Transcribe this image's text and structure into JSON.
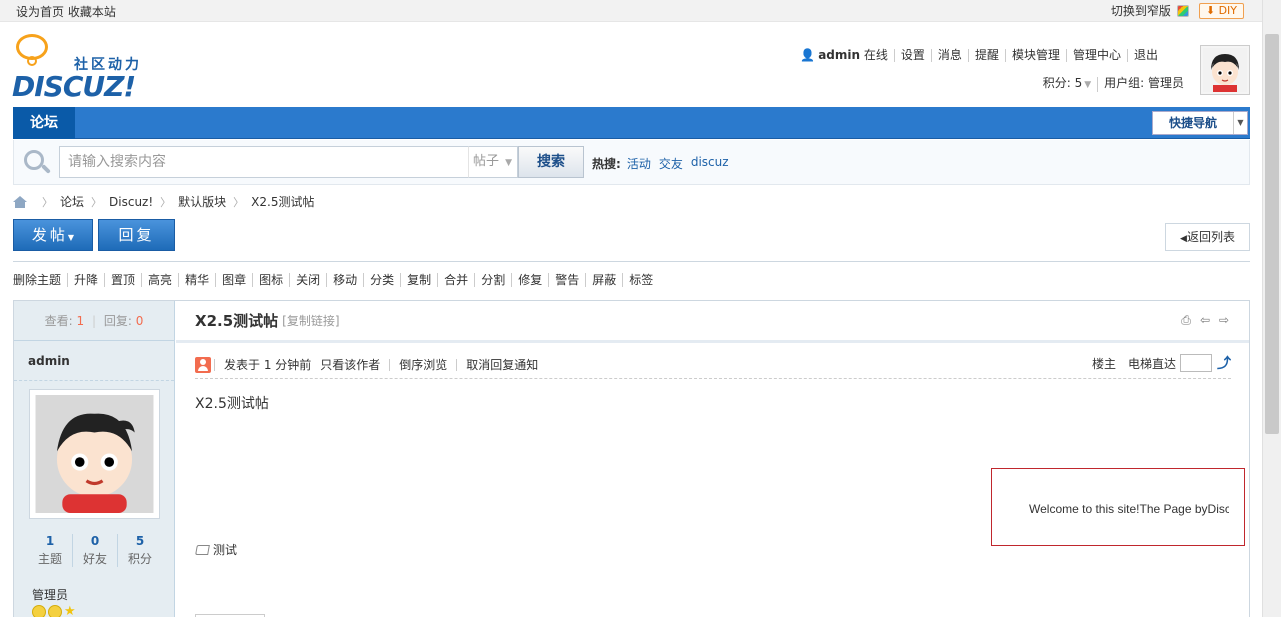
{
  "topbar": {
    "set_home": "设为首页",
    "bookmark": "收藏本站",
    "switch_width": "切换到窄版",
    "diy_label": "DIY",
    "diy_arrow": "⬇"
  },
  "logo": {
    "tagline": "社区动力",
    "wordmark": "DISCUZ!"
  },
  "user": {
    "name": "admin",
    "status": "在线",
    "links": [
      "设置",
      "消息",
      "提醒",
      "模块管理",
      "管理中心",
      "退出"
    ],
    "points_label": "积分: 5",
    "group_label": "用户组: 管理员"
  },
  "nav": {
    "forum_tab": "论坛",
    "quick_nav": "快捷导航"
  },
  "search": {
    "placeholder": "请输入搜索内容",
    "type": "帖子",
    "button": "搜索",
    "hot_label": "热搜:",
    "hot_links": [
      "活动",
      "交友",
      "discuz"
    ]
  },
  "breadcrumb": [
    "论坛",
    "Discuz!",
    "默认版块",
    "X2.5测试帖"
  ],
  "actions": {
    "post": "发帖",
    "reply": "回复",
    "back": "返回列表"
  },
  "moderation": [
    "删除主题",
    "升降",
    "置顶",
    "高亮",
    "精华",
    "图章",
    "图标",
    "关闭",
    "移动",
    "分类",
    "复制",
    "合并",
    "分割",
    "修复",
    "警告",
    "屏蔽",
    "标签"
  ],
  "thread": {
    "views_label": "查看:",
    "views": "1",
    "replies_label": "回复:",
    "replies": "0",
    "title": "X2.5测试帖",
    "copy_link": "[复制链接]"
  },
  "author": {
    "name": "admin",
    "stats": [
      {
        "value": "1",
        "label": "主题"
      },
      {
        "value": "0",
        "label": "好友"
      },
      {
        "value": "5",
        "label": "积分"
      }
    ],
    "group": "管理员"
  },
  "post": {
    "posted": "发表于 1 分钟前",
    "only_author": "只看该作者",
    "reverse": "倒序浏览",
    "cancel_notify": "取消回复通知",
    "floor": "楼主",
    "elevator": "电梯直达",
    "content": "X2.5测试帖",
    "tag": "测试",
    "ad_text": "Welcome to this site!The Page byDiscuz!"
  },
  "colors": {
    "brand_blue": "#2b7acd",
    "accent_orange": "#f26c4f",
    "ad_border": "#c0272d"
  }
}
